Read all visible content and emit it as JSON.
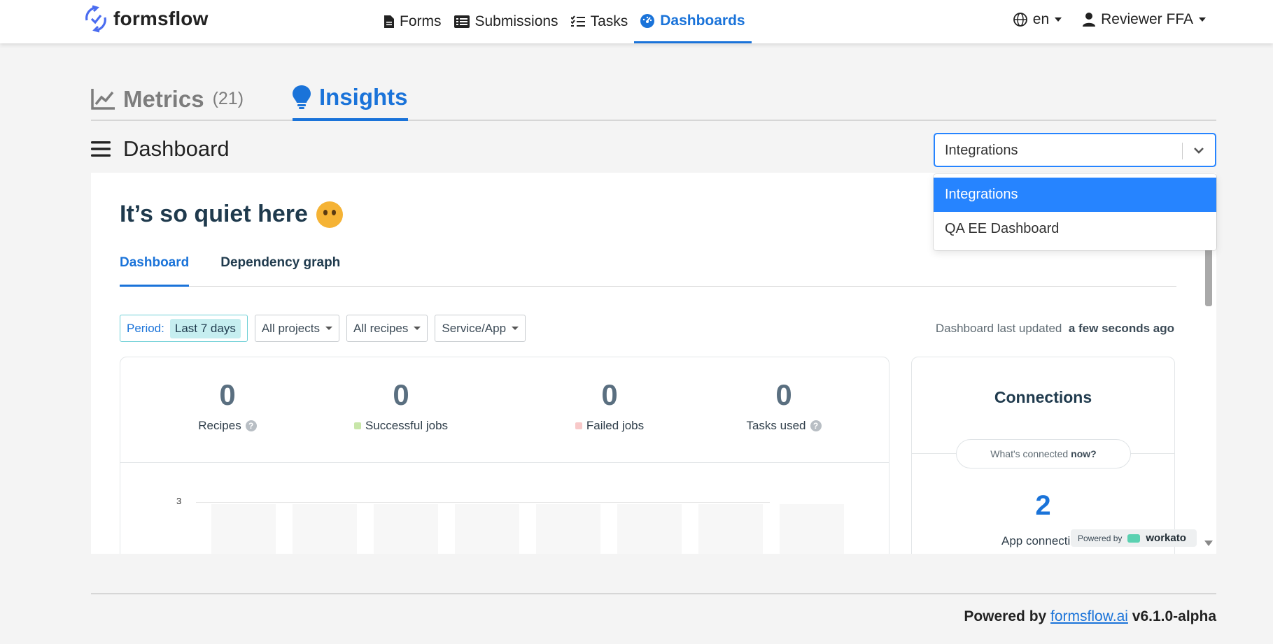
{
  "brand": {
    "name": "formsflow"
  },
  "nav": {
    "items": [
      {
        "label": "Forms",
        "icon": "file-icon"
      },
      {
        "label": "Submissions",
        "icon": "list-icon"
      },
      {
        "label": "Tasks",
        "icon": "tasks-icon"
      },
      {
        "label": "Dashboards",
        "icon": "dashboard-icon",
        "active": true
      }
    ],
    "language": "en",
    "user": "Reviewer FFA"
  },
  "tabs": {
    "metrics_label": "Metrics",
    "metrics_count": "(21)",
    "insights_label": "Insights"
  },
  "dashboard": {
    "title": "Dashboard",
    "select_value": "Integrations",
    "options": [
      "Integrations",
      "QA EE Dashboard"
    ]
  },
  "embed": {
    "heading": "It’s so quiet here",
    "tabs": [
      "Dashboard",
      "Dependency graph"
    ],
    "filters": {
      "period_label": "Period:",
      "period_value": "Last 7 days",
      "projects": "All projects",
      "recipes": "All recipes",
      "service": "Service/App"
    },
    "updated_label": "Dashboard last updated",
    "updated_value": "a few seconds ago",
    "stats": [
      {
        "value": "0",
        "label": "Recipes"
      },
      {
        "value": "0",
        "label": "Successful jobs",
        "color": "#c8e6a9"
      },
      {
        "value": "0",
        "label": "Failed jobs",
        "color": "#f8c9c9"
      },
      {
        "value": "0",
        "label": "Tasks used"
      }
    ],
    "chart_ytick": "3",
    "connections": {
      "title": "Connections",
      "pill_text": "What's connected",
      "pill_bold": "now?",
      "count": "2",
      "label": "App connecti"
    },
    "powered_badge": {
      "text": "Powered by",
      "brand": "workato"
    }
  },
  "footer": {
    "prefix": "Powered by",
    "link": "formsflow.ai",
    "version": "v6.1.0-alpha"
  },
  "colors": {
    "accent": "#1a73d9",
    "select_highlight": "#2684ff"
  }
}
